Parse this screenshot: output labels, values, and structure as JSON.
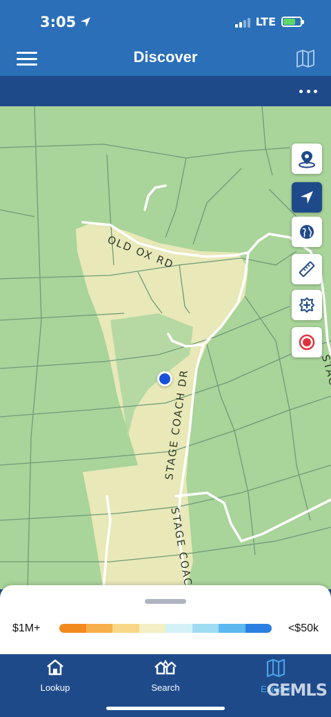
{
  "status_bar": {
    "time": "3:05",
    "network": "LTE"
  },
  "header": {
    "title": "Discover"
  },
  "map": {
    "road_labels": {
      "old_ox_rd": "OLD OX RD",
      "stage_coach_dr": "STAGE COACH DR",
      "stage_coach_lower": "STAGE COAC",
      "stage_coach_right": "STAGE COACH"
    },
    "colors": {
      "base": "#a9d49a",
      "highlight": "#e8e8b8",
      "parcel_line": "#6f9a78",
      "road": "#ffffff"
    }
  },
  "map_tools": [
    {
      "icon": "location-pin-icon",
      "active": false
    },
    {
      "icon": "navigation-arrow-icon",
      "active": true
    },
    {
      "icon": "globe-icon",
      "active": false
    },
    {
      "icon": "ruler-icon",
      "active": false
    },
    {
      "icon": "add-marker-icon",
      "active": false
    },
    {
      "icon": "record-icon",
      "active": false
    }
  ],
  "legend": {
    "max_label": "$1M+",
    "min_label": "<$50k",
    "colors": [
      "#f28a1e",
      "#f6b04a",
      "#f8d888",
      "#f4efc4",
      "#d4f2f6",
      "#9fdcf2",
      "#5cb8ee",
      "#2a7fe0"
    ]
  },
  "tab_bar": {
    "tabs": [
      {
        "label": "Lookup",
        "icon": "home-icon",
        "active": false
      },
      {
        "label": "Search",
        "icon": "houses-icon",
        "active": false
      },
      {
        "label": "Explore",
        "icon": "map-explore-icon",
        "active": true
      }
    ],
    "logo_text": "GEMLS"
  }
}
